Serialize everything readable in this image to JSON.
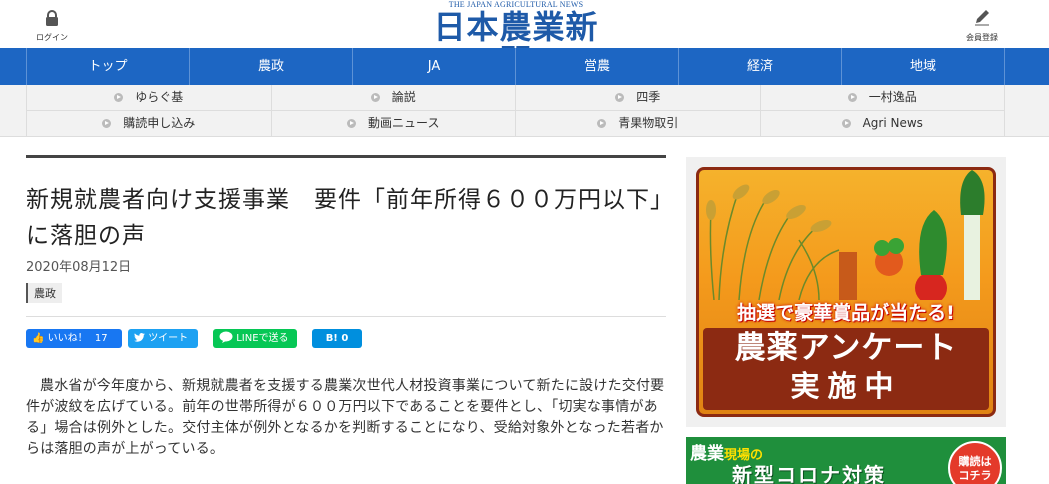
{
  "header": {
    "login_label": "ログイン",
    "register_label": "会員登録",
    "logo_en": "THE JAPAN AGRICULTURAL NEWS",
    "logo_ja": "日本農業新聞",
    "brand_color": "#1e5aa8"
  },
  "main_nav": {
    "color": "#1d66c3",
    "items": [
      "トップ",
      "農政",
      "JA",
      "営農",
      "経済",
      "地域"
    ]
  },
  "sub_nav": {
    "row1": [
      "ゆらぐ基",
      "論説",
      "四季",
      "一村逸品"
    ],
    "row2": [
      "購読申し込み",
      "動画ニュース",
      "青果物取引",
      "Agri News"
    ]
  },
  "article": {
    "title": "新規就農者向け支援事業　要件「前年所得６００万円以下」に落胆の声",
    "date": "2020年08月12日",
    "category": "農政",
    "share": {
      "facebook_label": "いいね！",
      "facebook_count": "17",
      "twitter_label": "ツイート",
      "line_label": "LINEで送る",
      "hatena_label": "B! 0"
    },
    "body": "農水省が今年度から、新規就農者を支援する農業次世代人材投資事業について新たに設けた交付要件が波紋を広げている。前年の世帯所得が６００万円以下であることを要件とし、「切実な事情がある」場合は例外とした。交付主体が例外となるかを判断することになり、受給対象外となった若者からは落胆の声が上がっている。"
  },
  "sidebar": {
    "ad1": {
      "lottery": "抽選で豪華賞品が当たる!",
      "line1": "農薬アンケート",
      "line2": "実施中"
    },
    "ad2": {
      "title_big": "農業",
      "title_small": "現場の",
      "headline": "新型コロナ対策",
      "circle": "購読は\nコチラ"
    }
  }
}
